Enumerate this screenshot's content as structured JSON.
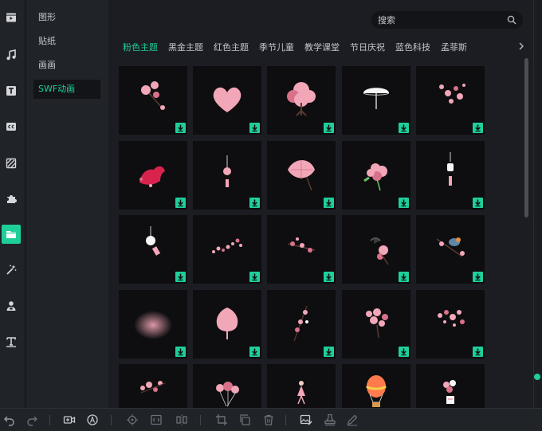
{
  "categories": [
    {
      "label": "图形"
    },
    {
      "label": "贴纸"
    },
    {
      "label": "画画"
    },
    {
      "label": "SWF动画"
    }
  ],
  "search": {
    "placeholder": "搜索"
  },
  "tabs": [
    {
      "label": "粉色主题"
    },
    {
      "label": "黑金主题"
    },
    {
      "label": "红色主题"
    },
    {
      "label": "季节儿童"
    },
    {
      "label": "教学课堂"
    },
    {
      "label": "节日庆祝"
    },
    {
      "label": "蓝色科技"
    },
    {
      "label": "孟菲斯"
    }
  ],
  "rail_icons": [
    "media-icon",
    "music-icon",
    "text-icon",
    "caption-icon",
    "filter-icon",
    "puzzle-icon",
    "folder-icon",
    "magic-wand-icon",
    "person-icon",
    "text-tool-icon"
  ],
  "grid_items": [
    "pink-blossom-branch",
    "pink-heart-cloud",
    "cherry-blossom-tree",
    "white-umbrella",
    "pink-petal-spray",
    "red-bird",
    "pink-ornament",
    "paper-umbrella",
    "pink-hydrangea",
    "wind-chime",
    "glass-wind-chime",
    "scattered-petals",
    "blossom-twig",
    "swallow-on-branch",
    "bird-on-branch",
    "pink-glow",
    "pink-tree",
    "hanging-blossoms",
    "blossom-cluster",
    "petal-burst",
    "sakura-branch",
    "pink-balloons",
    "dancing-girl",
    "hot-air-balloon",
    "balloon-bunch"
  ],
  "toolbar_icons": [
    "undo-icon",
    "redo-icon",
    "add-clip-icon",
    "record-icon",
    "target-icon",
    "fit-icon",
    "mirror-icon",
    "crop-icon",
    "duplicate-icon",
    "delete-icon",
    "image-edit-icon",
    "stamp-icon",
    "pen-icon"
  ],
  "colors": {
    "accent": "#1fcf9b",
    "background": "#1b1d22",
    "panel": "#202328",
    "tile": "#0e0e10",
    "blossom": "#f2a7b8"
  }
}
